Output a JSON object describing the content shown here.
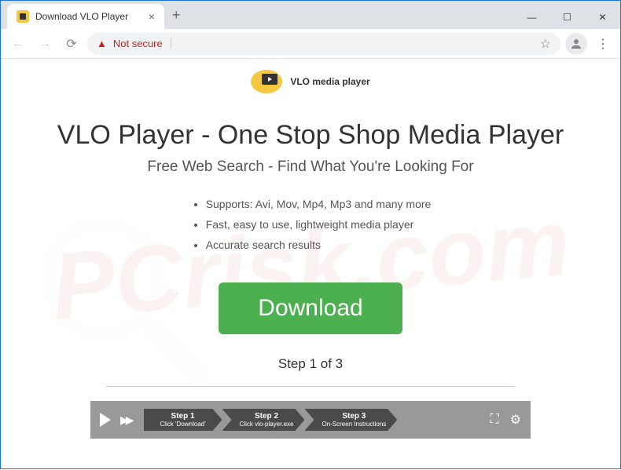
{
  "browser": {
    "tab_title": "Download VLO Player",
    "not_secure_label": "Not secure"
  },
  "logo": {
    "brand": "VLO media player"
  },
  "page": {
    "heading": "VLO Player - One Stop Shop Media Player",
    "subtitle": "Free Web Search - Find What You're Looking For",
    "features": [
      "Supports: Avi, Mov, Mp4, Mp3 and many more",
      "Fast, easy to use, lightweight media player",
      "Accurate search results"
    ],
    "download_label": "Download",
    "step_indicator": "Step 1 of 3"
  },
  "steps": [
    {
      "title": "Step 1",
      "sub": "Click 'Download'"
    },
    {
      "title": "Step 2",
      "sub": "Click vlo-player.exe"
    },
    {
      "title": "Step 3",
      "sub": "On-Screen Instructions"
    }
  ]
}
